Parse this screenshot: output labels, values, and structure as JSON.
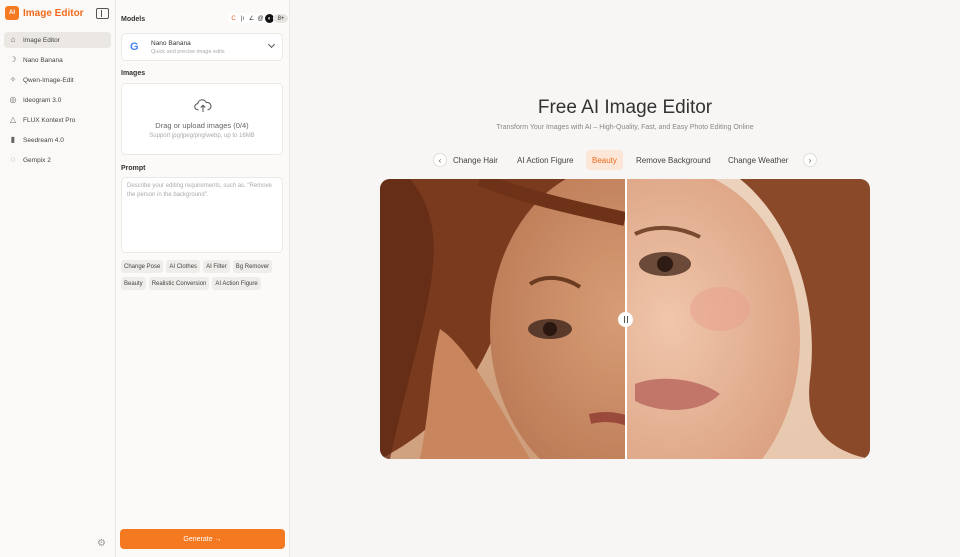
{
  "brand": {
    "logo_text": "AI",
    "name": "Image Editor"
  },
  "sidebar": {
    "items": [
      {
        "label": "Image Editor",
        "icon": "home-icon",
        "active": true
      },
      {
        "label": "Nano Banana",
        "icon": "banana-icon"
      },
      {
        "label": "Qwen-Image-Edit",
        "icon": "qwen-icon"
      },
      {
        "label": "Ideogram 3.0",
        "icon": "ideogram-icon"
      },
      {
        "label": "FLUX Kontext Pro",
        "icon": "flux-icon"
      },
      {
        "label": "Seedream 4.0",
        "icon": "seedream-icon"
      },
      {
        "label": "Gempix 2",
        "icon": "gempix-icon"
      }
    ]
  },
  "panel": {
    "models_label": "Models",
    "more_models": "8+",
    "model": {
      "name": "Nano Banana",
      "desc": "Quick and precise image edits",
      "logo": "G"
    },
    "images_label": "Images",
    "upload_title": "Drag or upload images  (0/4)",
    "upload_sub": "Support jpg/jpeg/png/webp, up to 16MB",
    "prompt_label": "Prompt",
    "prompt_placeholder": "Describe your editing requirements, such as. \"Remove the person in the background\".",
    "chips": [
      "Change Pose",
      "AI Clothes",
      "AI Filter",
      "Bg Remover",
      "Beauty",
      "Realistic Conversion",
      "AI Action Figure"
    ],
    "generate_label": "Generate  →"
  },
  "main": {
    "title": "Free AI Image Editor",
    "subtitle": "Transform Your Images with AI – High-Quality, Fast, and Easy Photo Editing Online",
    "tabs": [
      "Change Hair",
      "AI Action Figure",
      "Beauty",
      "Remove Background",
      "Change Weather"
    ],
    "active_tab": "Beauty",
    "comparison_position": 0.5
  },
  "colors": {
    "accent": "#f47920",
    "active_tab_bg": "#fbe6d7"
  }
}
